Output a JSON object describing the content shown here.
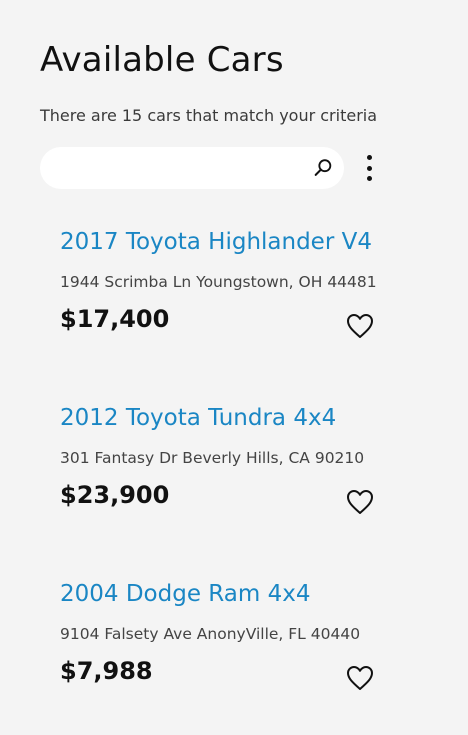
{
  "header": {
    "title": "Available Cars",
    "subtitle": "There are 15 cars that match your criteria"
  },
  "search": {
    "value": "",
    "placeholder": "",
    "icon": "search-icon"
  },
  "menu": {
    "icon": "more-vertical-icon"
  },
  "colors": {
    "background": "#f4f4f4",
    "link": "#1a86c4",
    "text": "#111111"
  },
  "cars": [
    {
      "title": "2017 Toyota Highlander V4",
      "address": "1944 Scrimba Ln Youngstown, OH 44481",
      "price": "$17,400",
      "favorite_icon": "heart-outline-icon"
    },
    {
      "title": "2012 Toyota Tundra 4x4",
      "address": "301 Fantasy Dr Beverly Hills, CA 90210",
      "price": "$23,900",
      "favorite_icon": "heart-outline-icon"
    },
    {
      "title": "2004 Dodge Ram 4x4",
      "address": "9104 Falsety Ave AnonyVille, FL 40440",
      "price": "$7,988",
      "favorite_icon": "heart-outline-icon"
    }
  ]
}
